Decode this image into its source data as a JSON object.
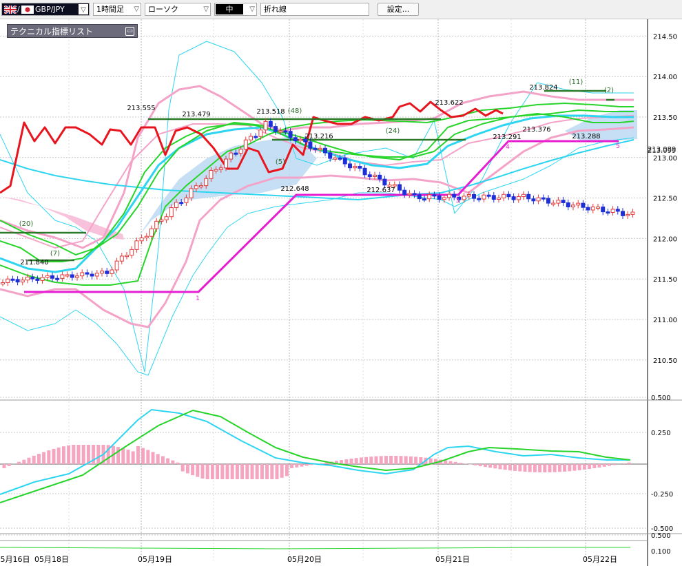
{
  "toolbar": {
    "symbol": "GBP/JPY",
    "timeframe": "1時間足",
    "chart_type": "ローソク",
    "color_preset": "中",
    "line_type": "折れ線",
    "settings_label": "設定..."
  },
  "panel": {
    "title": "テクニカル指標リスト"
  },
  "colors": {
    "up_candle": "#e23a3a",
    "down_candle": "#1f2fd8",
    "red_line": "#e8141e",
    "green": "#27d42a",
    "cyan": "#2ed5f0",
    "pink": "#f4a3c8",
    "magenta": "#e61ed2",
    "dark_green": "#2a7a2a",
    "cloud": "#bcd9f2",
    "cloud_pink": "#f9c2dc",
    "histogram": "#f5a5c0"
  },
  "chart_data": {
    "type": "candlestick",
    "price_axis": {
      "ticks": [
        "214.50",
        "214.00",
        "213.50",
        "213.00",
        "212.50",
        "212.00",
        "211.50",
        "211.00",
        "210.50"
      ],
      "current_price_labels": [
        "213.089",
        "213.099"
      ]
    },
    "macd_axis": {
      "ticks": [
        "0.500",
        "0.250",
        "-0.250",
        "-0.500"
      ]
    },
    "bottom_axis": {
      "ticks": [
        "0.500",
        "0.100"
      ]
    },
    "date_labels": [
      "5月16日",
      "05月18日",
      "05月19日",
      "05月20日",
      "05月21日",
      "05月22日"
    ],
    "price_annotations": [
      "213.555",
      "213.479",
      "213.518",
      "213.216",
      "212.648",
      "212.637",
      "213.622",
      "213.824",
      "213.376",
      "213.291",
      "213.288",
      "211.840"
    ],
    "period_labels": [
      "(20)",
      "(7)",
      "(48)",
      "(24)",
      "(11)",
      "(2)",
      "(5)"
    ],
    "wave_numbers": [
      "1",
      "3",
      "4",
      "5"
    ],
    "price_range": [
      210.3,
      214.65
    ]
  }
}
